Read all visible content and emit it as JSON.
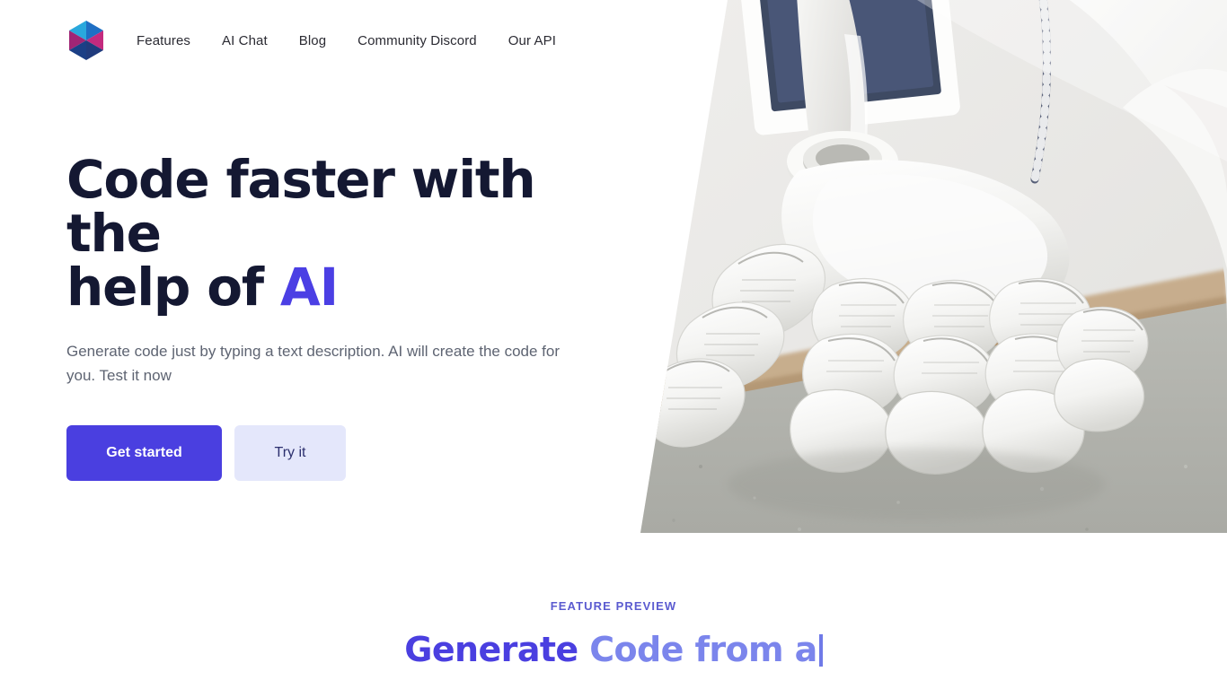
{
  "colors": {
    "brand_primary": "#4a3fe0",
    "brand_primary_soft": "#7b85ec",
    "btn_secondary_bg": "#e4e7fb",
    "btn_secondary_text": "#2b2f6e",
    "heading_dark": "#141832",
    "body_text": "#5e6472",
    "eyebrow": "#5b5bd0",
    "logo_cyan": "#29a8dd",
    "logo_blue": "#1f6fc4",
    "logo_magenta": "#a02575",
    "logo_pink": "#c42a7e",
    "logo_navy": "#1b3f86",
    "logo_indigo": "#203b7d"
  },
  "header": {
    "logo_name": "hexagon-pinwheel-logo",
    "nav": [
      {
        "label": "Features"
      },
      {
        "label": "AI Chat"
      },
      {
        "label": "Blog"
      },
      {
        "label": "Community Discord"
      },
      {
        "label": "Our API"
      }
    ]
  },
  "hero": {
    "title_line1": "Code faster with the",
    "title_line2_pre": "help of ",
    "title_accent": "AI",
    "subtitle": "Generate code just by typing a text description. AI will create the code for you. Test it now",
    "primary_button": "Get started",
    "secondary_button": "Try it",
    "image_alt": "white-robot-hand"
  },
  "preview": {
    "eyebrow": "FEATURE PREVIEW",
    "title_static": "Generate ",
    "title_typed": "Code from a"
  }
}
